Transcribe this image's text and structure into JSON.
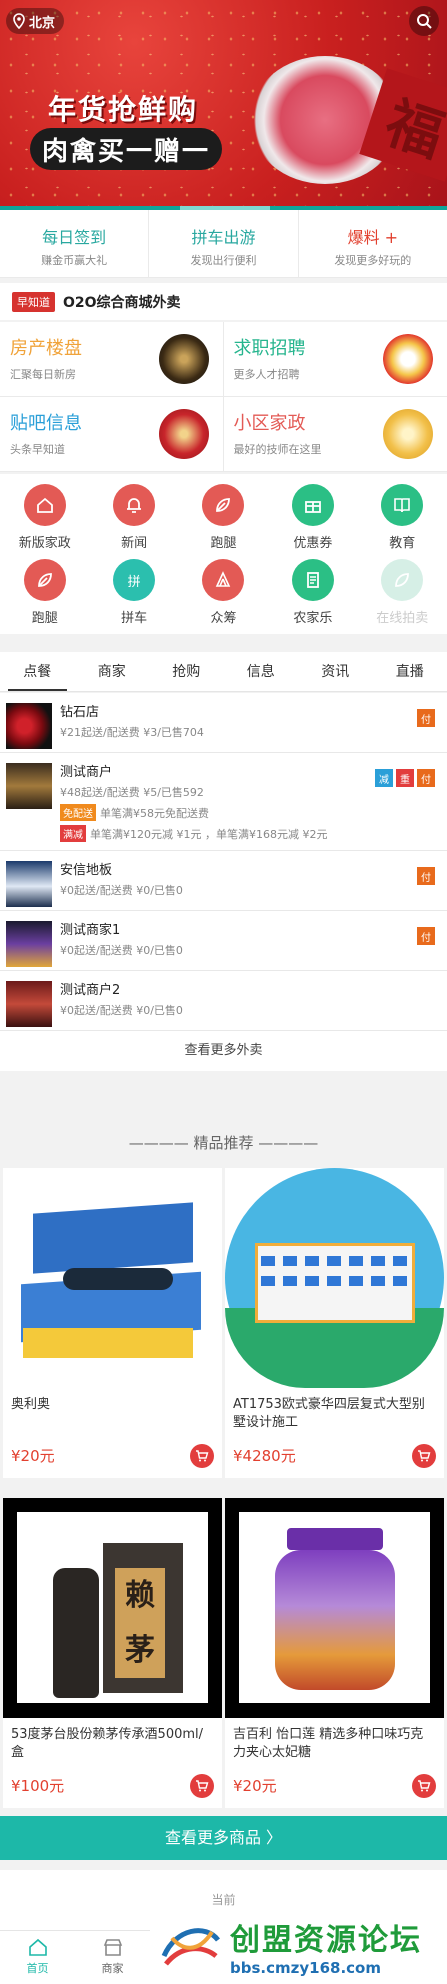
{
  "header": {
    "city": "北京",
    "banner_line1": "年货抢鲜购",
    "banner_line2": "肉禽买一赠一",
    "banner_char": "福"
  },
  "quick": [
    {
      "title": "每日签到",
      "sub": "赚金币赢大礼",
      "color": "#29a8a0"
    },
    {
      "title": "拼车出游",
      "sub": "发现出行便利",
      "color": "#29a8a0"
    },
    {
      "title": "爆料 +",
      "sub": "发现更多好玩的",
      "color": "#e2402f"
    }
  ],
  "news": {
    "tag": "早知道",
    "text": "O2O综合商城外卖"
  },
  "categories": [
    {
      "title": "房产楼盘",
      "sub": "汇聚每日新房",
      "color": "#f0a33a"
    },
    {
      "title": "求职招聘",
      "sub": "更多人才招聘",
      "color": "#26b58e"
    },
    {
      "title": "贴吧信息",
      "sub": "头条早知道",
      "color": "#2a9fd8"
    },
    {
      "title": "小区家政",
      "sub": "最好的技师在这里",
      "color": "#e35a55"
    }
  ],
  "icons": [
    {
      "label": "新版家政",
      "icon": "house-icon",
      "color": "#e35a55"
    },
    {
      "label": "新闻",
      "icon": "bell-icon",
      "color": "#e35a55"
    },
    {
      "label": "跑腿",
      "icon": "leaf-icon",
      "color": "#e35a55"
    },
    {
      "label": "优惠券",
      "icon": "gift-icon",
      "color": "#2bbf85"
    },
    {
      "label": "教育",
      "icon": "book-icon",
      "color": "#2bbf85"
    },
    {
      "label": "跑腿",
      "icon": "leaf-icon",
      "color": "#e35a55"
    },
    {
      "label": "拼车",
      "icon": "car-pool-icon",
      "color": "#2bbfae"
    },
    {
      "label": "众筹",
      "icon": "crowd-icon",
      "color": "#e35a55"
    },
    {
      "label": "农家乐",
      "icon": "farm-icon",
      "color": "#2bbf85"
    },
    {
      "label": "在线拍卖",
      "icon": "auction-icon",
      "color": "#d6efe6"
    }
  ],
  "tabs": [
    "点餐",
    "商家",
    "抢购",
    "信息",
    "资讯",
    "直播"
  ],
  "shops": [
    {
      "name": "钻石店",
      "meta": "¥21起送/配送费 ¥3/已售704",
      "badges": [
        "付"
      ]
    },
    {
      "name": "测试商户",
      "meta": "¥48起送/配送费 ¥5/已售592",
      "badges": [
        "减",
        "重",
        "付"
      ],
      "promos": [
        {
          "tag": "免配送",
          "text": "单笔满¥58元免配送费"
        },
        {
          "tag": "满减",
          "text": "单笔满¥120元减 ¥1元 ，单笔满¥168元减 ¥2元"
        }
      ]
    },
    {
      "name": "安信地板",
      "meta": "¥0起送/配送费 ¥0/已售0",
      "badges": [
        "付"
      ]
    },
    {
      "name": "测试商家1",
      "meta": "¥0起送/配送费 ¥0/已售0",
      "badges": [
        "付"
      ]
    },
    {
      "name": "测试商户2",
      "meta": "¥0起送/配送费 ¥0/已售0",
      "badges": []
    }
  ],
  "more_shops": "查看更多外卖",
  "recommend_title": "———— 精品推荐 ————",
  "goods": [
    {
      "name": "奥利奥",
      "price": "¥20元"
    },
    {
      "name": "AT1753欧式豪华四层复式大型别墅设计施工",
      "price": "¥4280元"
    },
    {
      "name": "53度茅台股份赖茅传承酒500ml/盒",
      "price": "¥100元"
    },
    {
      "name": "吉百利 怡口莲 精选多种口味巧克力夹心太妃糖",
      "price": "¥20元"
    }
  ],
  "more_goods": "查看更多商品 〉",
  "footer_note": "当前",
  "bottom_nav": [
    {
      "label": "首页"
    },
    {
      "label": "商家"
    }
  ],
  "watermark": {
    "title": "创盟资源论坛",
    "url": "bbs.cmzy168.com"
  }
}
